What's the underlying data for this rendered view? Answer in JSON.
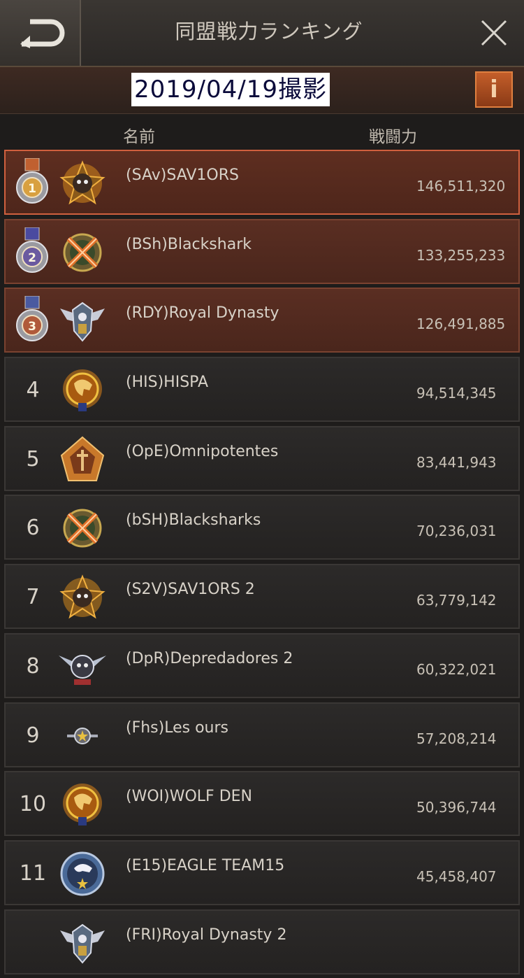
{
  "header": {
    "title": "同盟戦力ランキング",
    "date_label": "2019/04/19撮影",
    "info_label": "i"
  },
  "columns": {
    "name": "名前",
    "power": "戦闘力"
  },
  "rankings": [
    {
      "rank": "1",
      "name": "(SAv)SAV1ORS",
      "power": "146,511,320",
      "emblem": "skull-emblem-gold"
    },
    {
      "rank": "2",
      "name": "(BSh)Blackshark",
      "power": "133,255,233",
      "emblem": "crossed-swords-emblem"
    },
    {
      "rank": "3",
      "name": "(RDY)Royal Dynasty",
      "power": "126,491,885",
      "emblem": "eagle-wings-emblem"
    },
    {
      "rank": "4",
      "name": "(HIS)HISPA",
      "power": "94,514,345",
      "emblem": "eagle-head-emblem"
    },
    {
      "rank": "5",
      "name": "(OpE)Omnipotentes",
      "power": "83,441,943",
      "emblem": "star-shield-emblem"
    },
    {
      "rank": "6",
      "name": "(bSH)Blacksharks",
      "power": "70,236,031",
      "emblem": "crossed-swords-emblem"
    },
    {
      "rank": "7",
      "name": "(S2V)SAV1ORS 2",
      "power": "63,779,142",
      "emblem": "skull-emblem-gold"
    },
    {
      "rank": "8",
      "name": "(DpR)Depredadores 2",
      "power": "60,322,021",
      "emblem": "winged-skull-emblem"
    },
    {
      "rank": "9",
      "name": "(Fhs)Les ours",
      "power": "57,208,214",
      "emblem": "small-star-emblem"
    },
    {
      "rank": "10",
      "name": "(WOI)WOLF DEN",
      "power": "50,396,744",
      "emblem": "eagle-head-emblem"
    },
    {
      "rank": "11",
      "name": "(E15)EAGLE TEAM15",
      "power": "45,458,407",
      "emblem": "blue-eagle-emblem"
    },
    {
      "rank": "",
      "name": "(FRI)Royal Dynasty 2",
      "power": "",
      "emblem": "eagle-wings-emblem"
    }
  ],
  "colors": {
    "top_row_bg": "#5a2e22",
    "first_row_border": "#d0603e",
    "row_bg": "#2c2a29",
    "accent_orange": "#c45e2a"
  }
}
